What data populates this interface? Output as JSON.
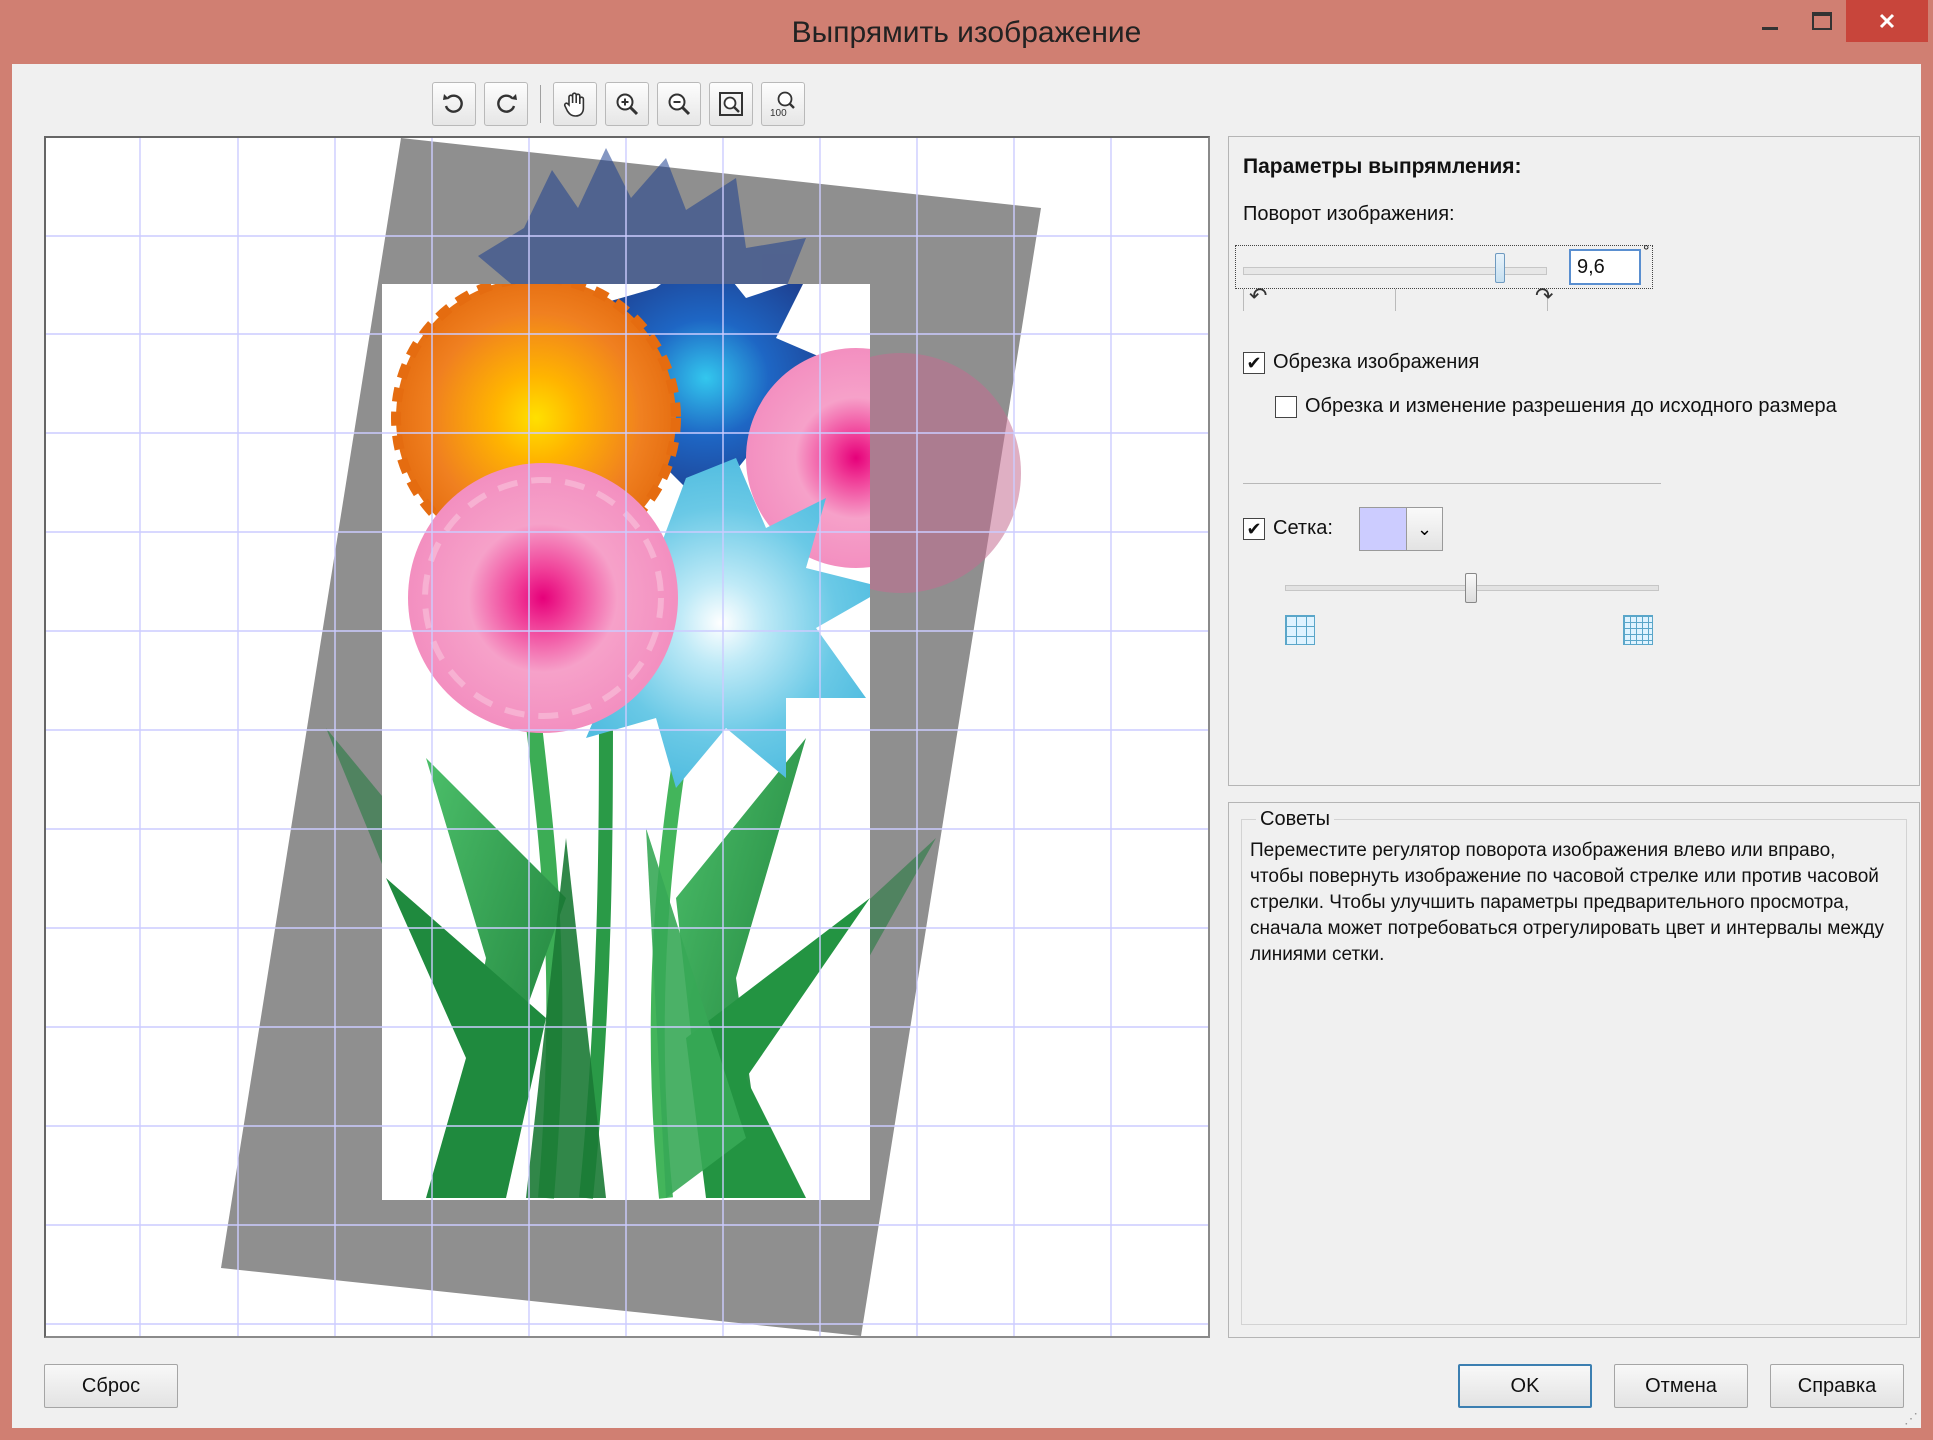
{
  "window": {
    "title": "Выпрямить изображение",
    "min_icon": "minimize-icon",
    "max_icon": "maximize-icon",
    "close_icon": "close-icon",
    "accent": "#d07f72",
    "close_color": "#c8453b"
  },
  "toolbar": {
    "buttons": [
      {
        "name": "rotate-left-button",
        "icon": "rotate-left-icon"
      },
      {
        "name": "rotate-right-button",
        "icon": "rotate-right-icon"
      },
      {
        "name": "pan-button",
        "icon": "hand-icon"
      },
      {
        "name": "zoom-in-button",
        "icon": "zoom-in-icon"
      },
      {
        "name": "zoom-out-button",
        "icon": "zoom-out-icon"
      },
      {
        "name": "fit-to-window-button",
        "icon": "fit-icon"
      },
      {
        "name": "zoom-100-button",
        "icon": "zoom-100-icon",
        "text": "100"
      }
    ]
  },
  "params": {
    "title": "Параметры выпрямления:",
    "rotation_label": "Поворот изображения:",
    "rotation_value": "9,6",
    "degree_symbol": "°",
    "rotate_ccw_glyph": "↶",
    "rotate_cw_glyph": "↷",
    "crop_label": "Обрезка изображения",
    "crop_checked": true,
    "crop_resample_label": "Обрезка и изменение разрешения до исходного размера",
    "crop_resample_checked": false,
    "grid_label": "Сетка:",
    "grid_checked": true,
    "grid_color": "#ccccff",
    "check_glyph": "✔",
    "dropdown_glyph": "⌄"
  },
  "tips": {
    "legend": "Советы",
    "text": "Переместите регулятор поворота изображения влево или вправо, чтобы повернуть изображение по часовой стрелке или против часовой стрелки. Чтобы улучшить параметры предварительного просмотра, сначала может потребоваться отрегулировать цвет и интервалы между линиями сетки."
  },
  "buttons": {
    "reset": "Сброс",
    "ok": "OK",
    "cancel": "Отмена",
    "help": "Справка"
  }
}
